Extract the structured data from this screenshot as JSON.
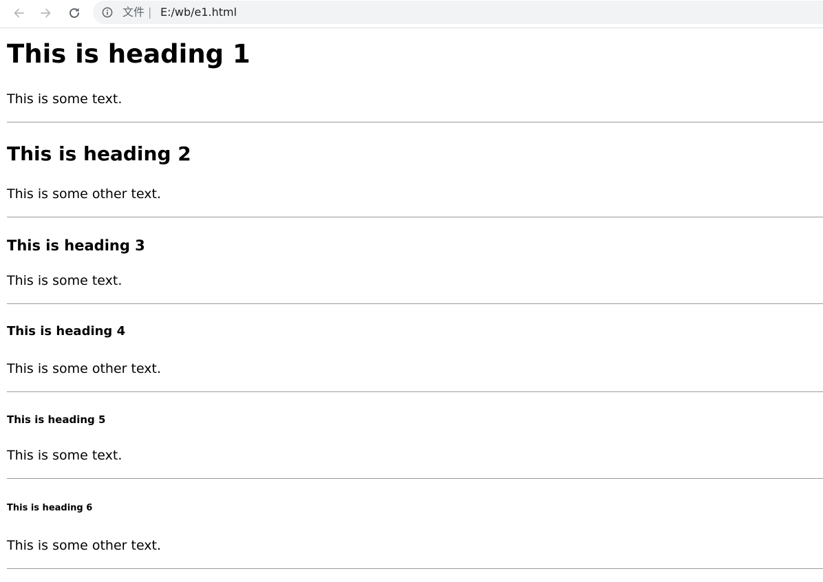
{
  "browser": {
    "url_scheme_label": "文件",
    "url_separator": "|",
    "url": "E:/wb/e1.html",
    "icons": {
      "back": "arrow-left-icon",
      "forward": "arrow-right-icon",
      "reload": "reload-icon",
      "info": "info-icon"
    }
  },
  "page": {
    "sections": [
      {
        "heading": "This is heading 1",
        "text": "This is some text."
      },
      {
        "heading": "This is heading 2",
        "text": "This is some other text."
      },
      {
        "heading": "This is heading 3",
        "text": "This is some text."
      },
      {
        "heading": "This is heading 4",
        "text": "This is some other text."
      },
      {
        "heading": "This is heading 5",
        "text": "This is some text."
      },
      {
        "heading": "This is heading 6",
        "text": "This is some other text."
      }
    ]
  }
}
